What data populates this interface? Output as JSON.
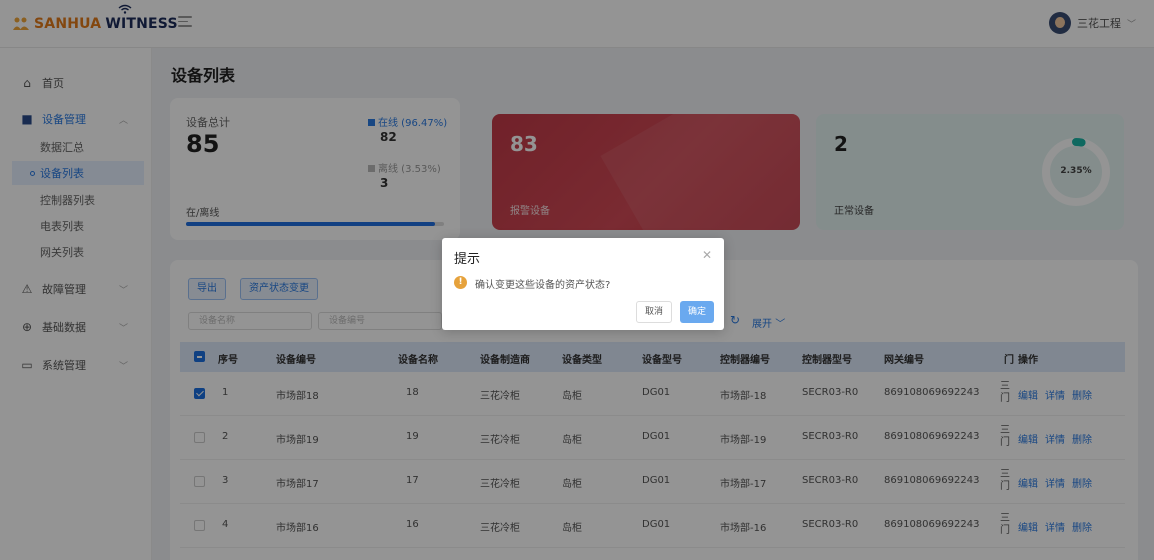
{
  "header": {
    "logo_brand": "SANHUA",
    "logo_product": "WITNESS",
    "user_name": "三花工程"
  },
  "sidebar": {
    "items": [
      {
        "label": "首页",
        "icon": "home-icon"
      },
      {
        "label": "设备管理",
        "icon": "device-icon",
        "open": true
      },
      {
        "label": "故障管理",
        "icon": "warning-icon"
      },
      {
        "label": "基础数据",
        "icon": "database-icon"
      },
      {
        "label": "系统管理",
        "icon": "monitor-icon"
      }
    ],
    "sub_items": [
      "数据汇总",
      "设备列表",
      "控制器列表",
      "电表列表",
      "网关列表"
    ],
    "active_sub": "设备列表"
  },
  "page": {
    "title": "设备列表"
  },
  "stats": {
    "total_label": "设备总计",
    "total_value": "85",
    "online_label": "在线 (96.47%)",
    "online_value": "82",
    "offline_label": "离线 (3.53%)",
    "offline_value": "3",
    "bar_label": "在/离线",
    "online_fraction": 0.9647,
    "alarm_value": "83",
    "alarm_label": "报警设备",
    "normal_value": "2",
    "normal_label": "正常设备",
    "normal_percent_text": "2.35%",
    "normal_fraction": 0.0235
  },
  "toolbar": {
    "export_label": "导出",
    "asset_status_label": "资产状态变更",
    "filter_name_placeholder": "设备名称",
    "filter_code_placeholder": "设备编号",
    "expand_label": "展开"
  },
  "table": {
    "columns": [
      "序号",
      "设备编号",
      "设备名称",
      "设备制造商",
      "设备类型",
      "设备型号",
      "控制器编号",
      "控制器型号",
      "网关编号",
      "门店",
      "操作"
    ],
    "column_door_short": "门",
    "rows": [
      {
        "idx": "1",
        "code": "市场部18",
        "name": "18",
        "maker": "三花冷柜",
        "type": "岛柜",
        "model": "DG01",
        "ctrl_code": "市场部-18",
        "ctrl_model": "SECR03-R0",
        "gateway": "869108069692243",
        "door": "三门",
        "checked": true
      },
      {
        "idx": "2",
        "code": "市场部19",
        "name": "19",
        "maker": "三花冷柜",
        "type": "岛柜",
        "model": "DG01",
        "ctrl_code": "市场部-19",
        "ctrl_model": "SECR03-R0",
        "gateway": "869108069692243",
        "door": "三门",
        "checked": false
      },
      {
        "idx": "3",
        "code": "市场部17",
        "name": "17",
        "maker": "三花冷柜",
        "type": "岛柜",
        "model": "DG01",
        "ctrl_code": "市场部-17",
        "ctrl_model": "SECR03-R0",
        "gateway": "869108069692243",
        "door": "三门",
        "checked": false
      },
      {
        "idx": "4",
        "code": "市场部16",
        "name": "16",
        "maker": "三花冷柜",
        "type": "岛柜",
        "model": "DG01",
        "ctrl_code": "市场部-16",
        "ctrl_model": "SECR03-R0",
        "gateway": "869108069692243",
        "door": "三门",
        "checked": false
      }
    ],
    "ops": [
      "编辑",
      "详情",
      "删除"
    ]
  },
  "dialog": {
    "title": "提示",
    "message": "确认变更这些设备的资产状态?",
    "cancel_label": "取消",
    "ok_label": "确定"
  },
  "colors": {
    "accent": "#2a7ae2",
    "alarm": "#c8404c",
    "normal_bg": "#e3f3f2",
    "gauge": "#1bb5a6",
    "warning": "#e6a23c"
  }
}
